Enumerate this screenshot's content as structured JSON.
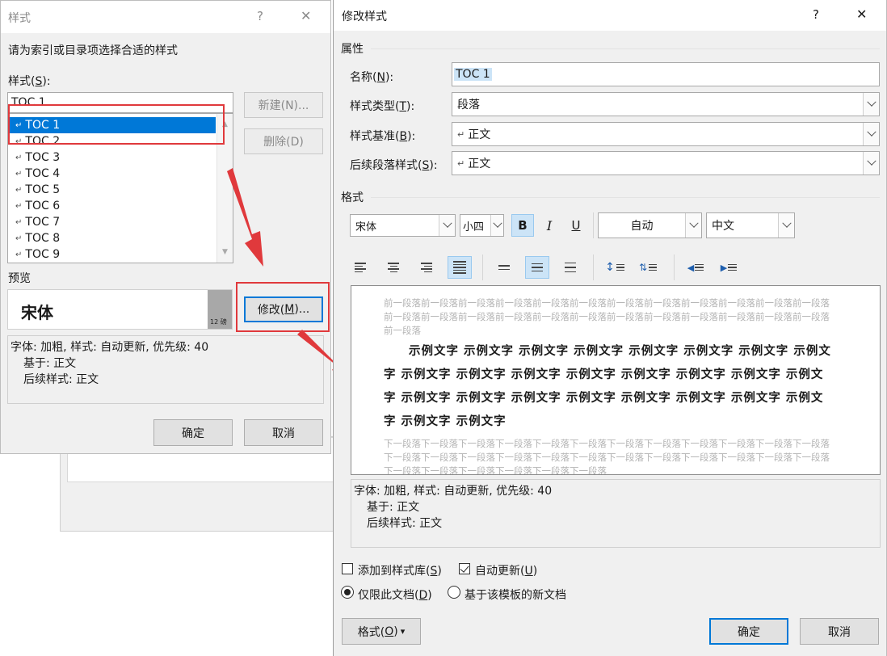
{
  "style_dialog": {
    "title": "样式",
    "help": "?",
    "close": "✕",
    "prompt": "请为索引或目录项选择合适的样式",
    "styles_label_pre": "样式(",
    "styles_label_key": "S",
    "styles_label_post": "):",
    "style_input_value": "TOC 1",
    "style_items": [
      "TOC 1",
      "TOC 2",
      "TOC 3",
      "TOC 4",
      "TOC 5",
      "TOC 6",
      "TOC 7",
      "TOC 8",
      "TOC 9"
    ],
    "return_symbol": "↵",
    "new_button": "新建(N)...",
    "delete_button": "删除(D)",
    "preview_label": "预览",
    "preview_font": "宋体",
    "preview_size": "12 磅",
    "modify_pre": "修改(",
    "modify_key": "M",
    "modify_post": ")...",
    "desc_line1": "字体: 加粗, 样式: 自动更新, 优先级: 40",
    "desc_line2": "基于: 正文",
    "desc_line3": "后续样式: 正文",
    "ok_button": "确定",
    "cancel_button": "取消"
  },
  "modify_dialog": {
    "title": "修改样式",
    "help": "?",
    "close": "✕",
    "properties_heading": "属性",
    "name_pre": "名称(",
    "name_key": "N",
    "name_post": "):",
    "name_value": "TOC 1",
    "type_pre": "样式类型(",
    "type_key": "T",
    "type_post": "):",
    "type_value": "段落",
    "based_pre": "样式基准(",
    "based_key": "B",
    "based_post": "):",
    "based_value": "正文",
    "next_pre": "后续段落样式(",
    "next_key": "S",
    "next_post": "):",
    "next_value": "正文",
    "format_heading": "格式",
    "font_value": "宋体",
    "size_value": "小四",
    "bold": "B",
    "italic": "I",
    "underline": "U",
    "color_value": "自动",
    "lang_value": "中文",
    "preview_prev": "前一段落前一段落前一段落前一段落前一段落前一段落前一段落前一段落前一段落前一段落前一段落前一段落前一段落前一段落前一段落前一段落前一段落前一段落前一段落前一段落前一段落前一段落前一段落前一段落前一段落",
    "preview_sample": "示例文字 示例文字 示例文字 示例文字 示例文字 示例文字 示例文字 示例文字 示例文字 示例文字 示例文字 示例文字 示例文字 示例文字 示例文字 示例文字 示例文字 示例文字 示例文字 示例文字 示例文字 示例文字 示例文字 示例文字 示例文字 示例文字",
    "preview_next": "下一段落下一段落下一段落下一段落下一段落下一段落下一段落下一段落下一段落下一段落下一段落下一段落下一段落下一段落下一段落下一段落下一段落下一段落下一段落下一段落下一段落下一段落下一段落下一段落下一段落下一段落下一段落下一段落下一段落下一段落",
    "desc_line1": "字体: 加粗, 样式: 自动更新, 优先级: 40",
    "desc_line2": "基于: 正文",
    "desc_line3": "后续样式: 正文",
    "add_gallery_pre": "添加到样式库(",
    "add_gallery_key": "S",
    "add_gallery_post": ")",
    "auto_update_pre": "自动更新(",
    "auto_update_key": "U",
    "auto_update_post": ")",
    "only_doc_pre": "仅限此文档(",
    "only_doc_key": "D",
    "only_doc_post": ")",
    "template_label": "基于该模板的新文档",
    "format_btn_pre": "格式(",
    "format_btn_key": "O",
    "format_btn_post": ")",
    "format_btn_arrow": "▾",
    "ok_button": "确定",
    "cancel_button": "取消"
  },
  "colors": {
    "accent": "#0078d7",
    "selection": "#0078d7",
    "highlight_red": "#e0393c"
  }
}
